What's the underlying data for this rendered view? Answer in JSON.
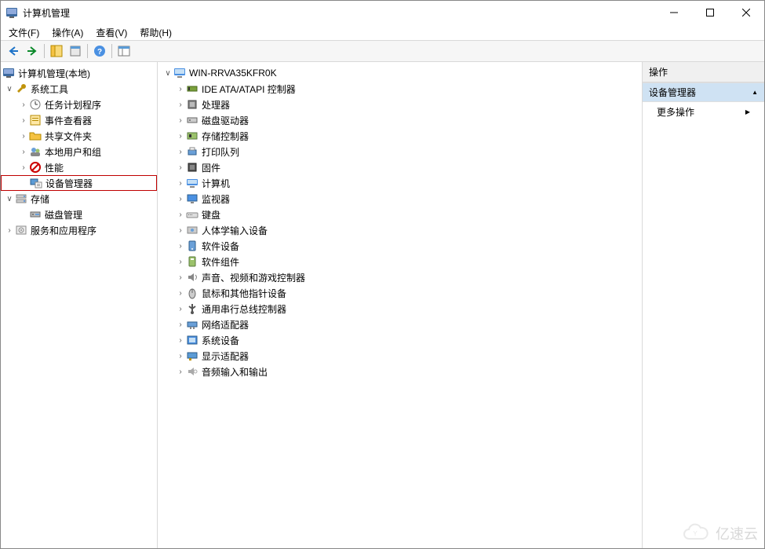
{
  "window": {
    "title": "计算机管理"
  },
  "menu": {
    "file": "文件(F)",
    "action": "操作(A)",
    "view": "查看(V)",
    "help": "帮助(H)"
  },
  "left_tree": {
    "root": "计算机管理(本地)",
    "system_tools": "系统工具",
    "items": {
      "task_scheduler": "任务计划程序",
      "event_viewer": "事件查看器",
      "shared_folders": "共享文件夹",
      "local_users": "本地用户和组",
      "performance": "性能",
      "device_manager": "设备管理器"
    },
    "storage": "存储",
    "disk_mgmt": "磁盘管理",
    "services_apps": "服务和应用程序"
  },
  "device_tree": {
    "root": "WIN-RRVA35KFR0K",
    "categories": {
      "ide": "IDE ATA/ATAPI 控制器",
      "processors": "处理器",
      "disk_drives": "磁盘驱动器",
      "storage_ctrl": "存储控制器",
      "print_queues": "打印队列",
      "firmware": "固件",
      "computer": "计算机",
      "monitors": "监视器",
      "keyboards": "键盘",
      "hid": "人体学输入设备",
      "sw_devices": "软件设备",
      "sw_components": "软件组件",
      "sound": "声音、视频和游戏控制器",
      "mice": "鼠标和其他指针设备",
      "usb": "通用串行总线控制器",
      "network": "网络适配器",
      "system_devices": "系统设备",
      "display": "显示适配器",
      "audio_io": "音频输入和输出"
    }
  },
  "right": {
    "header": "操作",
    "section1_title": "设备管理器",
    "more_actions": "更多操作"
  },
  "watermark": "亿速云"
}
